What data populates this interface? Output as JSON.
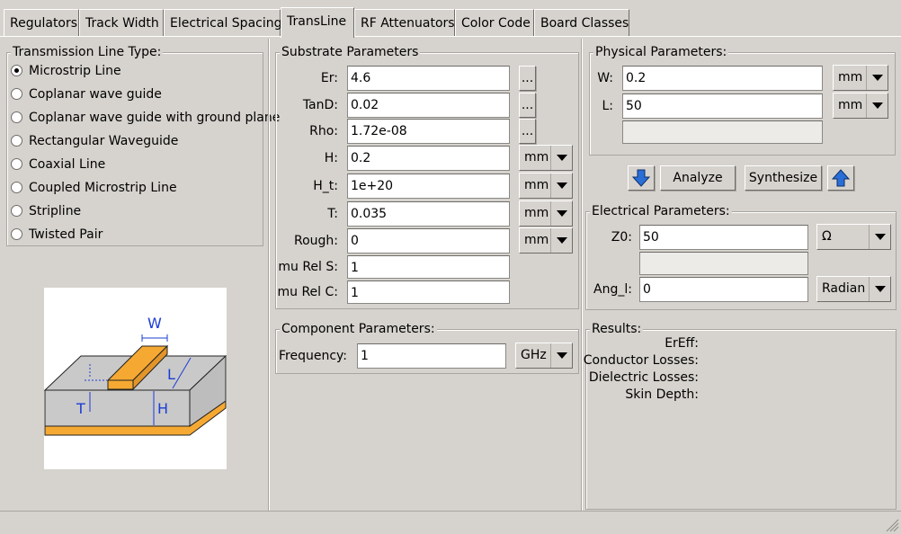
{
  "tabs": [
    "Regulators",
    "Track Width",
    "Electrical Spacing",
    "TransLine",
    "RF Attenuators",
    "Color Code",
    "Board Classes"
  ],
  "active_tab": "TransLine",
  "line_type": {
    "title": "Transmission Line Type:",
    "options": [
      "Microstrip Line",
      "Coplanar wave guide",
      "Coplanar wave guide with ground plane",
      "Rectangular Waveguide",
      "Coaxial Line",
      "Coupled Microstrip Line",
      "Stripline",
      "Twisted Pair"
    ],
    "selected": "Microstrip Line"
  },
  "diagram": {
    "label_w": "W",
    "label_l": "L",
    "label_t": "T",
    "label_h": "H"
  },
  "substrate": {
    "title": "Substrate Parameters",
    "er_label": "Er:",
    "er_value": "4.6",
    "tand_label": "TanD:",
    "tand_value": "0.02",
    "rho_label": "Rho:",
    "rho_value": "1.72e-08",
    "h_label": "H:",
    "h_value": "0.2",
    "h_unit": "mm",
    "ht_label": "H_t:",
    "ht_value": "1e+20",
    "ht_unit": "mm",
    "t_label": "T:",
    "t_value": "0.035",
    "t_unit": "mm",
    "rough_label": "Rough:",
    "rough_value": "0",
    "rough_unit": "mm",
    "murels_label": "mu Rel S:",
    "murels_value": "1",
    "murelc_label": "mu Rel C:",
    "murelc_value": "1",
    "ellipsis": "..."
  },
  "component": {
    "title": "Component Parameters:",
    "freq_label": "Frequency:",
    "freq_value": "1",
    "freq_unit": "GHz"
  },
  "physical": {
    "title": "Physical Parameters:",
    "w_label": "W:",
    "w_value": "0.2",
    "w_unit": "mm",
    "l_label": "L:",
    "l_value": "50",
    "l_unit": "mm",
    "extra_value": ""
  },
  "actions": {
    "analyze": "Analyze",
    "synthesize": "Synthesize"
  },
  "electrical": {
    "title": "Electrical Parameters:",
    "z0_label": "Z0:",
    "z0_value": "50",
    "z0_unit": "Ω",
    "extra_value": "",
    "ang_label": "Ang_l:",
    "ang_value": "0",
    "ang_unit": "Radian"
  },
  "results": {
    "title": "Results:",
    "items": [
      "ErEff:",
      "Conductor Losses:",
      "Dielectric Losses:",
      "Skin Depth:"
    ]
  },
  "colors": {
    "accent_arrow": "#2a6fd6",
    "copper": "#f6a932",
    "substrate": "#c9c9c9"
  }
}
